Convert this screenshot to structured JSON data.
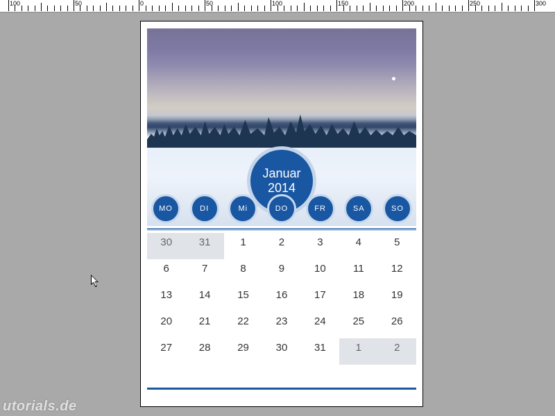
{
  "ruler": {
    "ticks": [
      "100",
      "50",
      "0",
      "50",
      "100",
      "150",
      "200",
      "250",
      "300"
    ]
  },
  "calendar": {
    "month": "Januar",
    "year": "2014",
    "titleCombined": "Januar\n2014",
    "weekdays": [
      "MO",
      "DI",
      "Mi",
      "DO",
      "FR",
      "SA",
      "SO"
    ],
    "weeks": [
      [
        {
          "d": "30",
          "out": true
        },
        {
          "d": "31",
          "out": true
        },
        {
          "d": "1"
        },
        {
          "d": "2"
        },
        {
          "d": "3"
        },
        {
          "d": "4"
        },
        {
          "d": "5"
        }
      ],
      [
        {
          "d": "6"
        },
        {
          "d": "7"
        },
        {
          "d": "8"
        },
        {
          "d": "9"
        },
        {
          "d": "10"
        },
        {
          "d": "11"
        },
        {
          "d": "12"
        }
      ],
      [
        {
          "d": "13"
        },
        {
          "d": "14"
        },
        {
          "d": "15"
        },
        {
          "d": "16"
        },
        {
          "d": "17"
        },
        {
          "d": "18"
        },
        {
          "d": "19"
        }
      ],
      [
        {
          "d": "20"
        },
        {
          "d": "21"
        },
        {
          "d": "22"
        },
        {
          "d": "23"
        },
        {
          "d": "24"
        },
        {
          "d": "25"
        },
        {
          "d": "26"
        }
      ],
      [
        {
          "d": "27"
        },
        {
          "d": "28"
        },
        {
          "d": "29"
        },
        {
          "d": "30"
        },
        {
          "d": "31"
        },
        {
          "d": "1",
          "out": true
        },
        {
          "d": "2",
          "out": true
        }
      ]
    ]
  },
  "watermark": "utorials.de",
  "colors": {
    "brand": "#1957a3"
  }
}
